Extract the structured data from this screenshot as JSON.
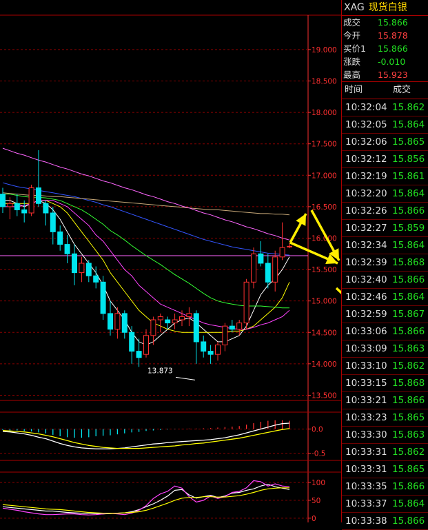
{
  "quote": {
    "symbol": "XAG",
    "name": "现货白银",
    "rows": [
      {
        "label": "成交",
        "value": "15.866",
        "color": "green"
      },
      {
        "label": "今开",
        "value": "15.878",
        "color": "red"
      },
      {
        "label": "买价1",
        "value": "15.866",
        "color": "green"
      },
      {
        "label": "涨跌",
        "value": "-0.010",
        "color": "green"
      },
      {
        "label": "最高",
        "value": "15.923",
        "color": "red"
      }
    ]
  },
  "ticks": {
    "col_time": "时间",
    "col_price": "成交",
    "rows": [
      {
        "time": "10:32:04",
        "price": "15.862"
      },
      {
        "time": "10:32:05",
        "price": "15.864"
      },
      {
        "time": "10:32:06",
        "price": "15.865"
      },
      {
        "time": "10:32:12",
        "price": "15.856"
      },
      {
        "time": "10:32:19",
        "price": "15.861"
      },
      {
        "time": "10:32:20",
        "price": "15.864"
      },
      {
        "time": "10:32:26",
        "price": "15.866"
      },
      {
        "time": "10:32:27",
        "price": "15.859"
      },
      {
        "time": "10:32:34",
        "price": "15.864"
      },
      {
        "time": "10:32:39",
        "price": "15.868"
      },
      {
        "time": "10:32:40",
        "price": "15.866"
      },
      {
        "time": "10:32:46",
        "price": "15.864"
      },
      {
        "time": "10:32:59",
        "price": "15.867"
      },
      {
        "time": "10:33:06",
        "price": "15.866"
      },
      {
        "time": "10:33:09",
        "price": "15.863"
      },
      {
        "time": "10:33:10",
        "price": "15.862"
      },
      {
        "time": "10:33:15",
        "price": "15.868"
      },
      {
        "time": "10:33:21",
        "price": "15.866"
      },
      {
        "time": "10:33:23",
        "price": "15.865"
      },
      {
        "time": "10:33:30",
        "price": "15.863"
      },
      {
        "time": "10:33:31",
        "price": "15.862"
      },
      {
        "time": "10:33:31",
        "price": "15.865"
      },
      {
        "time": "10:33:35",
        "price": "15.866"
      },
      {
        "time": "10:33:37",
        "price": "15.864"
      },
      {
        "time": "10:33:38",
        "price": "15.866"
      }
    ]
  },
  "colors": {
    "up": "#ff3030",
    "down": "#00e5ee",
    "grid": "#8b0000",
    "axis": "#ff3030"
  },
  "chart_data": [
    {
      "type": "candlestick",
      "yticks": [
        13.5,
        14.0,
        14.5,
        15.0,
        15.5,
        16.0,
        16.5,
        17.0,
        17.5,
        18.0,
        18.5,
        19.0
      ],
      "ytick_labels": [
        "13.500",
        "14.000",
        "14.500",
        "15.000",
        "15.500",
        "16.000",
        "16.500",
        "17.000",
        "17.500",
        "18.000",
        "18.500",
        "19.000"
      ],
      "ylim": [
        13.45,
        19.35
      ],
      "min_annotation": {
        "value": 13.873,
        "label": "13.873"
      },
      "reference_line": 15.72,
      "candles": [
        [
          16.7,
          16.8,
          16.4,
          16.5
        ],
        [
          16.5,
          16.65,
          16.3,
          16.55
        ],
        [
          16.55,
          16.7,
          16.35,
          16.45
        ],
        [
          16.45,
          16.6,
          16.25,
          16.4
        ],
        [
          16.4,
          16.85,
          16.35,
          16.8
        ],
        [
          16.8,
          17.4,
          16.5,
          16.55
        ],
        [
          16.55,
          16.6,
          16.2,
          16.4
        ],
        [
          16.4,
          16.5,
          15.9,
          16.1
        ],
        [
          16.1,
          16.2,
          15.8,
          15.9
        ],
        [
          15.9,
          16.05,
          15.6,
          15.75
        ],
        [
          15.75,
          15.9,
          15.25,
          15.45
        ],
        [
          15.45,
          15.7,
          15.3,
          15.6
        ],
        [
          15.6,
          15.65,
          15.3,
          15.4
        ],
        [
          15.4,
          15.55,
          15.2,
          15.3
        ],
        [
          15.3,
          15.4,
          14.7,
          14.8
        ],
        [
          14.8,
          15.0,
          14.45,
          14.55
        ],
        [
          14.55,
          14.9,
          14.4,
          14.8
        ],
        [
          14.8,
          14.85,
          14.4,
          14.5
        ],
        [
          14.5,
          14.6,
          14.0,
          14.2
        ],
        [
          14.2,
          14.4,
          13.95,
          14.1
        ],
        [
          14.15,
          14.55,
          14.1,
          14.45
        ],
        [
          14.45,
          14.75,
          14.3,
          14.7
        ],
        [
          14.7,
          14.8,
          14.5,
          14.75
        ],
        [
          14.7,
          14.75,
          14.55,
          14.65
        ],
        [
          14.65,
          14.8,
          14.55,
          14.7
        ],
        [
          14.7,
          14.85,
          14.6,
          14.75
        ],
        [
          14.75,
          14.9,
          14.6,
          14.8
        ],
        [
          14.8,
          14.85,
          14.0,
          14.35
        ],
        [
          14.35,
          14.45,
          14.1,
          14.2
        ],
        [
          14.2,
          14.3,
          14.0,
          14.15
        ],
        [
          14.15,
          14.35,
          14.05,
          14.3
        ],
        [
          14.3,
          14.65,
          14.2,
          14.6
        ],
        [
          14.6,
          14.7,
          14.5,
          14.55
        ],
        [
          14.55,
          14.7,
          14.45,
          14.65
        ],
        [
          14.65,
          15.35,
          14.55,
          15.3
        ],
        [
          15.3,
          15.85,
          15.2,
          15.75
        ],
        [
          15.75,
          15.95,
          15.55,
          15.6
        ],
        [
          15.6,
          15.75,
          15.2,
          15.3
        ],
        [
          15.3,
          15.8,
          15.15,
          15.7
        ],
        [
          15.7,
          16.25,
          15.65,
          15.85
        ],
        [
          15.86,
          15.92,
          15.84,
          15.87
        ]
      ],
      "moving_averages": [
        {
          "color": "#ffffff",
          "values": [
            16.6,
            16.6,
            16.55,
            16.5,
            16.55,
            16.6,
            16.55,
            16.45,
            16.3,
            16.1,
            15.9,
            15.75,
            15.6,
            15.45,
            15.25,
            15.0,
            14.85,
            14.7,
            14.5,
            14.35,
            14.3,
            14.35,
            14.45,
            14.55,
            14.65,
            14.7,
            14.73,
            14.65,
            14.55,
            14.45,
            14.35,
            14.35,
            14.4,
            14.45,
            14.6,
            14.85,
            15.1,
            15.25,
            15.35,
            15.5,
            15.7
          ]
        },
        {
          "color": "#ffff00",
          "values": [
            16.55,
            16.55,
            16.55,
            16.55,
            16.55,
            16.6,
            16.6,
            16.55,
            16.5,
            16.4,
            16.25,
            16.1,
            15.95,
            15.8,
            15.65,
            15.45,
            15.3,
            15.15,
            15.0,
            14.85,
            14.75,
            14.65,
            14.6,
            14.55,
            14.52,
            14.5,
            14.5,
            14.5,
            14.5,
            14.5,
            14.5,
            14.5,
            14.52,
            14.52,
            14.55,
            14.6,
            14.7,
            14.8,
            14.9,
            15.05,
            15.3
          ]
        },
        {
          "color": "#ff44ff",
          "values": [
            16.5,
            16.5,
            16.5,
            16.52,
            16.55,
            16.6,
            16.6,
            16.6,
            16.55,
            16.5,
            16.4,
            16.3,
            16.2,
            16.05,
            15.95,
            15.8,
            15.65,
            15.5,
            15.4,
            15.25,
            15.15,
            15.05,
            14.95,
            14.9,
            14.85,
            14.8,
            14.75,
            14.7,
            14.65,
            14.62,
            14.6,
            14.58,
            14.56,
            14.55,
            14.55,
            14.58,
            14.62,
            14.65,
            14.7,
            14.75,
            14.85
          ]
        },
        {
          "color": "#33ff33",
          "values": [
            16.7,
            16.7,
            16.68,
            16.66,
            16.65,
            16.65,
            16.64,
            16.62,
            16.6,
            16.55,
            16.5,
            16.45,
            16.38,
            16.3,
            16.22,
            16.12,
            16.05,
            15.97,
            15.88,
            15.8,
            15.72,
            15.65,
            15.58,
            15.5,
            15.42,
            15.35,
            15.28,
            15.2,
            15.12,
            15.05,
            15.0,
            14.97,
            14.95,
            14.93,
            14.92,
            14.92,
            14.92,
            14.91,
            14.9,
            14.89,
            14.89
          ]
        },
        {
          "color": "#3355ff",
          "values": [
            16.88,
            16.85,
            16.82,
            16.8,
            16.78,
            16.76,
            16.74,
            16.72,
            16.7,
            16.68,
            16.66,
            16.63,
            16.6,
            16.57,
            16.53,
            16.5,
            16.46,
            16.42,
            16.38,
            16.34,
            16.3,
            16.26,
            16.22,
            16.18,
            16.14,
            16.1,
            16.06,
            16.02,
            15.98,
            15.95,
            15.92,
            15.89,
            15.86,
            15.84,
            15.82,
            15.8,
            15.78,
            15.76,
            15.75,
            15.74,
            15.73
          ]
        },
        {
          "color": "#c8a878",
          "values": [
            16.72,
            16.71,
            16.7,
            16.69,
            16.68,
            16.68,
            16.67,
            16.66,
            16.66,
            16.65,
            16.64,
            16.63,
            16.62,
            16.61,
            16.6,
            16.59,
            16.58,
            16.57,
            16.56,
            16.55,
            16.54,
            16.53,
            16.52,
            16.51,
            16.5,
            16.49,
            16.48,
            16.47,
            16.46,
            16.45,
            16.45,
            16.44,
            16.43,
            16.42,
            16.41,
            16.4,
            16.39,
            16.39,
            16.38,
            16.38,
            16.37
          ]
        },
        {
          "color": "#ff66ff",
          "values": [
            17.43,
            17.39,
            17.35,
            17.32,
            17.28,
            17.24,
            17.21,
            17.17,
            17.13,
            17.1,
            17.06,
            17.02,
            16.99,
            16.95,
            16.91,
            16.88,
            16.84,
            16.8,
            16.77,
            16.73,
            16.69,
            16.66,
            16.62,
            16.58,
            16.55,
            16.51,
            16.48,
            16.44,
            16.4,
            16.37,
            16.33,
            16.29,
            16.26,
            16.22,
            16.18,
            16.15,
            16.11,
            16.07,
            16.04,
            16.0,
            15.97
          ]
        }
      ]
    },
    {
      "type": "bar",
      "yticks": [
        0.0,
        -0.5
      ],
      "ytick_labels": [
        "0.0",
        "-0.5"
      ],
      "ylim": [
        -0.62,
        0.32
      ],
      "values": [
        -0.02,
        -0.03,
        -0.03,
        -0.04,
        -0.05,
        -0.07,
        -0.09,
        -0.12,
        -0.15,
        -0.17,
        -0.18,
        -0.18,
        -0.17,
        -0.15,
        -0.14,
        -0.13,
        -0.11,
        -0.09,
        -0.07,
        -0.06,
        -0.04,
        -0.03,
        -0.02,
        -0.01,
        -0.005,
        0.005,
        0.01,
        0.01,
        0.015,
        0.02,
        0.03,
        0.04,
        0.05,
        0.06,
        0.09,
        0.12,
        0.15,
        0.17,
        0.18,
        0.18,
        0.17
      ],
      "series": [
        {
          "color": "#ffffff",
          "values": [
            -0.05,
            -0.06,
            -0.08,
            -0.1,
            -0.13,
            -0.17,
            -0.2,
            -0.25,
            -0.3,
            -0.34,
            -0.37,
            -0.39,
            -0.4,
            -0.41,
            -0.41,
            -0.41,
            -0.4,
            -0.39,
            -0.37,
            -0.35,
            -0.33,
            -0.31,
            -0.3,
            -0.28,
            -0.27,
            -0.26,
            -0.25,
            -0.24,
            -0.23,
            -0.22,
            -0.2,
            -0.18,
            -0.15,
            -0.12,
            -0.08,
            -0.04,
            0.0,
            0.04,
            0.08,
            0.11,
            0.12
          ]
        },
        {
          "color": "#ffff00",
          "values": [
            -0.03,
            -0.04,
            -0.05,
            -0.06,
            -0.08,
            -0.1,
            -0.13,
            -0.16,
            -0.2,
            -0.24,
            -0.28,
            -0.31,
            -0.34,
            -0.36,
            -0.38,
            -0.39,
            -0.4,
            -0.4,
            -0.4,
            -0.4,
            -0.39,
            -0.38,
            -0.37,
            -0.36,
            -0.35,
            -0.33,
            -0.32,
            -0.3,
            -0.29,
            -0.27,
            -0.25,
            -0.23,
            -0.21,
            -0.19,
            -0.16,
            -0.13,
            -0.1,
            -0.07,
            -0.04,
            -0.01,
            0.01
          ]
        }
      ]
    },
    {
      "type": "line",
      "yticks": [
        100,
        50,
        0
      ],
      "ytick_labels": [
        "100",
        "50",
        "0"
      ],
      "ylim": [
        -8,
        125
      ],
      "series": [
        {
          "color": "#ffffff",
          "values": [
            32,
            30,
            28,
            26,
            24,
            22,
            20,
            20,
            18,
            16,
            15,
            14,
            14,
            13,
            12,
            13,
            14,
            15,
            18,
            24,
            32,
            40,
            50,
            62,
            78,
            80,
            65,
            56,
            60,
            64,
            58,
            62,
            70,
            72,
            78,
            82,
            90,
            95,
            88,
            84,
            80
          ]
        },
        {
          "color": "#ff44ff",
          "values": [
            28,
            25,
            22,
            18,
            15,
            12,
            10,
            10,
            11,
            12,
            12,
            10,
            9,
            10,
            12,
            14,
            12,
            10,
            14,
            22,
            35,
            55,
            68,
            75,
            90,
            84,
            60,
            45,
            50,
            62,
            55,
            60,
            72,
            75,
            85,
            105,
            102,
            90,
            96,
            90,
            88
          ]
        },
        {
          "color": "#ffff00",
          "values": [
            38,
            36,
            34,
            32,
            30,
            28,
            26,
            25,
            24,
            22,
            20,
            18,
            16,
            15,
            14,
            14,
            14,
            15,
            16,
            18,
            22,
            28,
            35,
            42,
            50,
            56,
            58,
            58,
            60,
            60,
            59,
            59,
            61,
            63,
            67,
            72,
            78,
            82,
            84,
            85,
            85
          ]
        }
      ]
    }
  ]
}
